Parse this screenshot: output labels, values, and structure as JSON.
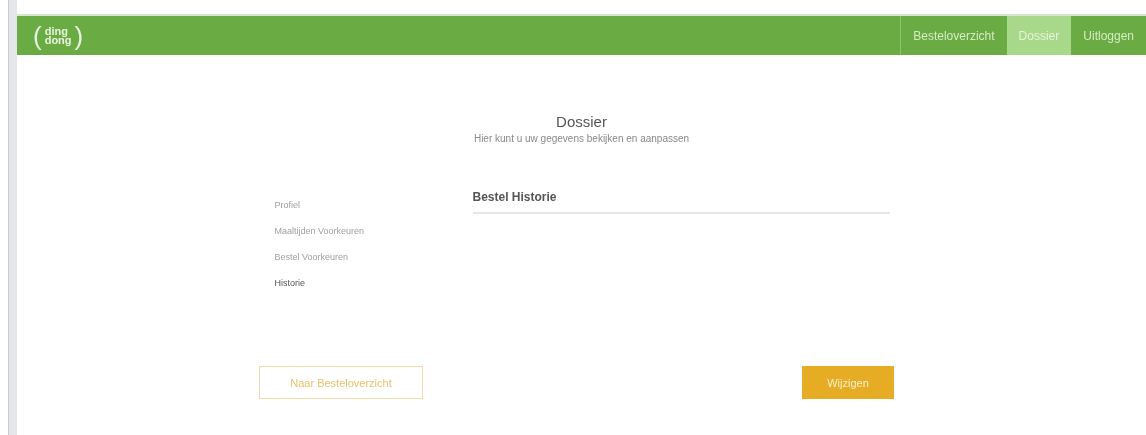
{
  "header": {
    "logo": {
      "open": "(",
      "top": "ding",
      "bottom": "dong",
      "close": ")"
    },
    "nav": [
      {
        "label": "Besteloverzicht",
        "selected": false
      },
      {
        "label": "Dossier",
        "selected": true
      },
      {
        "label": "Uitloggen",
        "selected": false
      }
    ]
  },
  "page": {
    "title": "Dossier",
    "subtitle": "Hier kunt u uw gegevens bekijken en aanpassen"
  },
  "sidebar": {
    "items": [
      {
        "label": "Profiel",
        "selected": false
      },
      {
        "label": "Maaltijden Voorkeuren",
        "selected": false
      },
      {
        "label": "Bestel Voorkeuren",
        "selected": false
      },
      {
        "label": "Historie",
        "selected": true
      }
    ]
  },
  "content": {
    "heading": "Bestel Historie"
  },
  "buttons": [
    {
      "label": "Naar Besteloverzicht",
      "kind": "outline"
    },
    {
      "label": "Wijzigen",
      "kind": "primary"
    }
  ]
}
